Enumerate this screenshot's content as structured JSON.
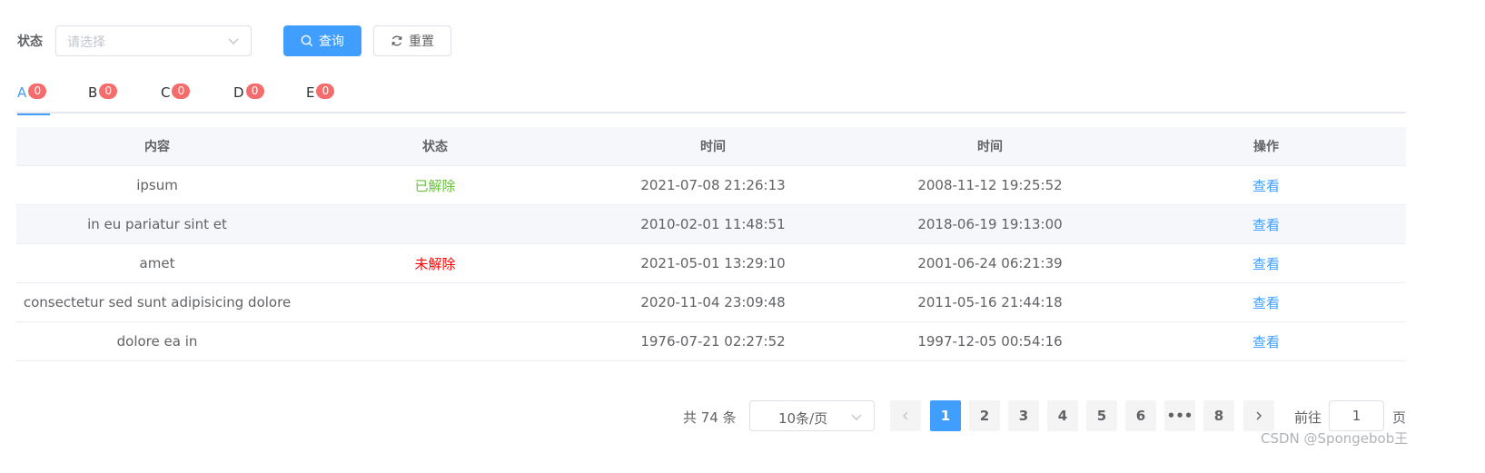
{
  "filter": {
    "status_label": "状态",
    "status_placeholder": "请选择",
    "query_label": "查询",
    "reset_label": "重置"
  },
  "tabs": [
    {
      "label": "A",
      "count": "0",
      "active": true
    },
    {
      "label": "B",
      "count": "0",
      "active": false
    },
    {
      "label": "C",
      "count": "0",
      "active": false
    },
    {
      "label": "D",
      "count": "0",
      "active": false
    },
    {
      "label": "E",
      "count": "0",
      "active": false
    }
  ],
  "table": {
    "headers": [
      "内容",
      "状态",
      "时间",
      "时间",
      "操作"
    ],
    "rows": [
      {
        "content": "ipsum",
        "status": "已解除",
        "status_type": "ok",
        "time1": "2021-07-08 21:26:13",
        "time2": "2008-11-12 19:25:52",
        "action": "查看"
      },
      {
        "content": "in eu pariatur sint et",
        "status": "",
        "status_type": "",
        "time1": "2010-02-01 11:48:51",
        "time2": "2018-06-19 19:13:00",
        "action": "查看"
      },
      {
        "content": "amet",
        "status": "未解除",
        "status_type": "bad",
        "time1": "2021-05-01 13:29:10",
        "time2": "2001-06-24 06:21:39",
        "action": "查看"
      },
      {
        "content": "consectetur sed sunt adipisicing dolore",
        "status": "",
        "status_type": "",
        "time1": "2020-11-04 23:09:48",
        "time2": "2011-05-16 21:44:18",
        "action": "查看"
      },
      {
        "content": "dolore ea in",
        "status": "",
        "status_type": "",
        "time1": "1976-07-21 02:27:52",
        "time2": "1997-12-05 00:54:16",
        "action": "查看"
      }
    ]
  },
  "pagination": {
    "total": "共 74 条",
    "page_size": "10条/页",
    "pages": [
      "1",
      "2",
      "3",
      "4",
      "5",
      "6",
      "•••",
      "8"
    ],
    "current_page": "1",
    "goto_label": "前往",
    "goto_value": "1",
    "goto_suffix": "页"
  },
  "watermark": "CSDN @Spongebob王",
  "colors": {
    "primary": "#409eff",
    "success": "#67c23a",
    "danger": "#ff0000",
    "badge": "#f56c6c"
  }
}
